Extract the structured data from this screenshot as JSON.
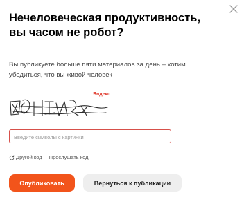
{
  "dialog": {
    "title": "Нечеловеческая продуктивность, вы часом не робот?",
    "description": "Вы публикуете больше пяти материалов за день – хотим убедиться, что вы живой человек"
  },
  "captcha": {
    "brand": "Яндекс",
    "input_placeholder": "Введите символы с картинки",
    "input_value": "",
    "other_code_label": "Другой код",
    "listen_code_label": "Прослушать код"
  },
  "buttons": {
    "publish_label": "Опубликовать",
    "back_label": "Вернуться к публикации"
  },
  "icons": {
    "close": "close-icon",
    "refresh": "refresh-icon"
  },
  "colors": {
    "primary": "#f2541b",
    "input_border": "#d7504a",
    "brand": "#e03b2e"
  }
}
